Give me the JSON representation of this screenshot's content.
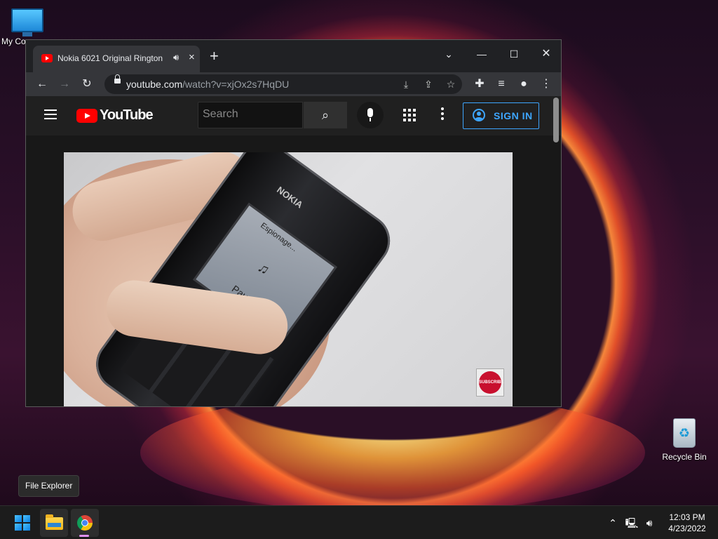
{
  "desktop": {
    "icons": [
      {
        "label": "My Co"
      },
      {
        "label": "Recycle Bin"
      }
    ],
    "tooltip": "File Explorer"
  },
  "browser": {
    "tab": {
      "title": "Nokia 6021 Original Rington",
      "audio_icon": "speaker-icon",
      "close": "×"
    },
    "new_tab": "+",
    "window_controls": [
      "chevron-down-icon",
      "minimize-icon",
      "maximize-icon",
      "close-icon"
    ],
    "toolbar": {
      "url_host": "youtube.com",
      "url_path": "/watch?v=xjOx2s7HqDU"
    }
  },
  "youtube": {
    "logo_text": "YouTube",
    "search_placeholder": "Search",
    "sign_in": "SIGN IN",
    "video": {
      "screen_title": "Espionage...",
      "screen_softkey": "Pause",
      "brand": "NOKIA",
      "subscribe": "SUBSCRIBE"
    }
  },
  "taskbar": {
    "items": [
      "start",
      "file-explorer",
      "chrome"
    ],
    "clock": {
      "time": "12:03 PM",
      "date": "4/23/2022"
    }
  },
  "colors": {
    "accent_blue": "#3ea6ff",
    "youtube_red": "#ff0000",
    "chrome_tab_bg": "#35363a",
    "taskbar_bg": "#1c1c1c"
  }
}
